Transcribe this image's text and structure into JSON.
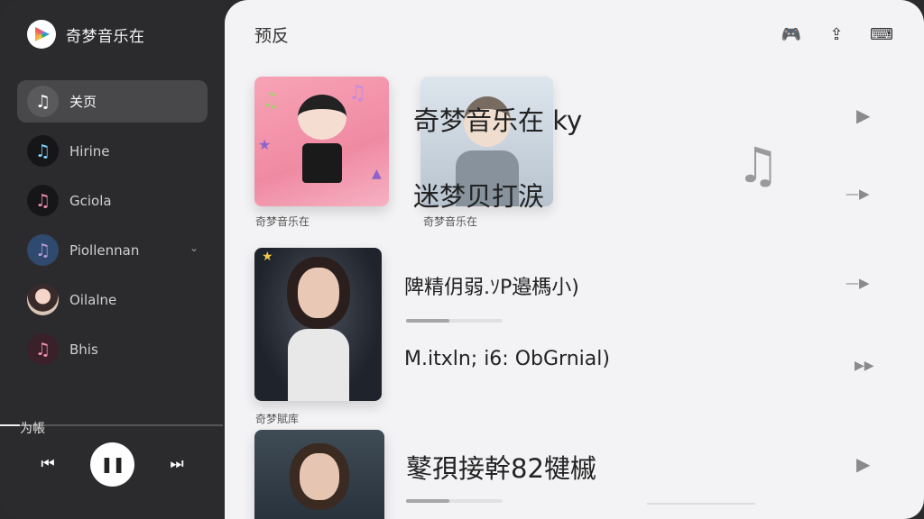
{
  "app": {
    "name": "奇梦音乐在",
    "brand_colors": [
      "#f2c94c",
      "#eb5757",
      "#bb6bd9",
      "#2d9cdb",
      "#27ae60"
    ]
  },
  "sidebar": {
    "items": [
      {
        "label": "关页",
        "icon": "music-note-icon",
        "icon_color": "#ffffff",
        "active": true
      },
      {
        "label": "Hirine",
        "icon": "music-note-icon",
        "icon_color": "#7fd3ff",
        "active": false
      },
      {
        "label": "Gciola",
        "icon": "music-note-icon",
        "icon_color": "#f48fb1",
        "active": false
      },
      {
        "label": "Piollennan",
        "icon": "music-note-icon",
        "icon_color": "#b39ddb",
        "active": false,
        "expandable": true
      },
      {
        "label": "Oilalne",
        "icon": "avatar",
        "active": false
      },
      {
        "label": "Bhis",
        "icon": "music-note-icon",
        "icon_color": "#f48fb1",
        "active": false
      }
    ],
    "player": {
      "label": "为帳",
      "progress": 0.09,
      "prev_icon": "skip-previous-icon",
      "play_icon": "pause-icon",
      "next_icon": "skip-next-icon"
    }
  },
  "main": {
    "title": "预反",
    "top_icons": [
      "gamepad-icon",
      "share-icon",
      "keyboard-icon"
    ],
    "covers": [
      {
        "caption": "奇梦音乐在"
      },
      {
        "caption": "奇梦音乐在"
      },
      {
        "caption": "奇梦賦库"
      },
      {
        "caption": ""
      }
    ],
    "tracks": [
      {
        "title": "奇梦音乐在 ky",
        "play_icon": "play-icon"
      },
      {
        "title": "迷梦贝打涙",
        "play_icon": "play-icon"
      },
      {
        "title": "陴精仴弱.ｿP邉榪小)",
        "play_icon": "play-icon",
        "progress": 0.45
      },
      {
        "title": "M.itxln; i6: ObGrnial)",
        "play_icon": "fast-forward-icon"
      },
      {
        "title": "鼕孭接幹82犍槭",
        "play_icon": "play-icon",
        "progress": 0.45
      }
    ],
    "decor_icon": "music-note-icon"
  }
}
